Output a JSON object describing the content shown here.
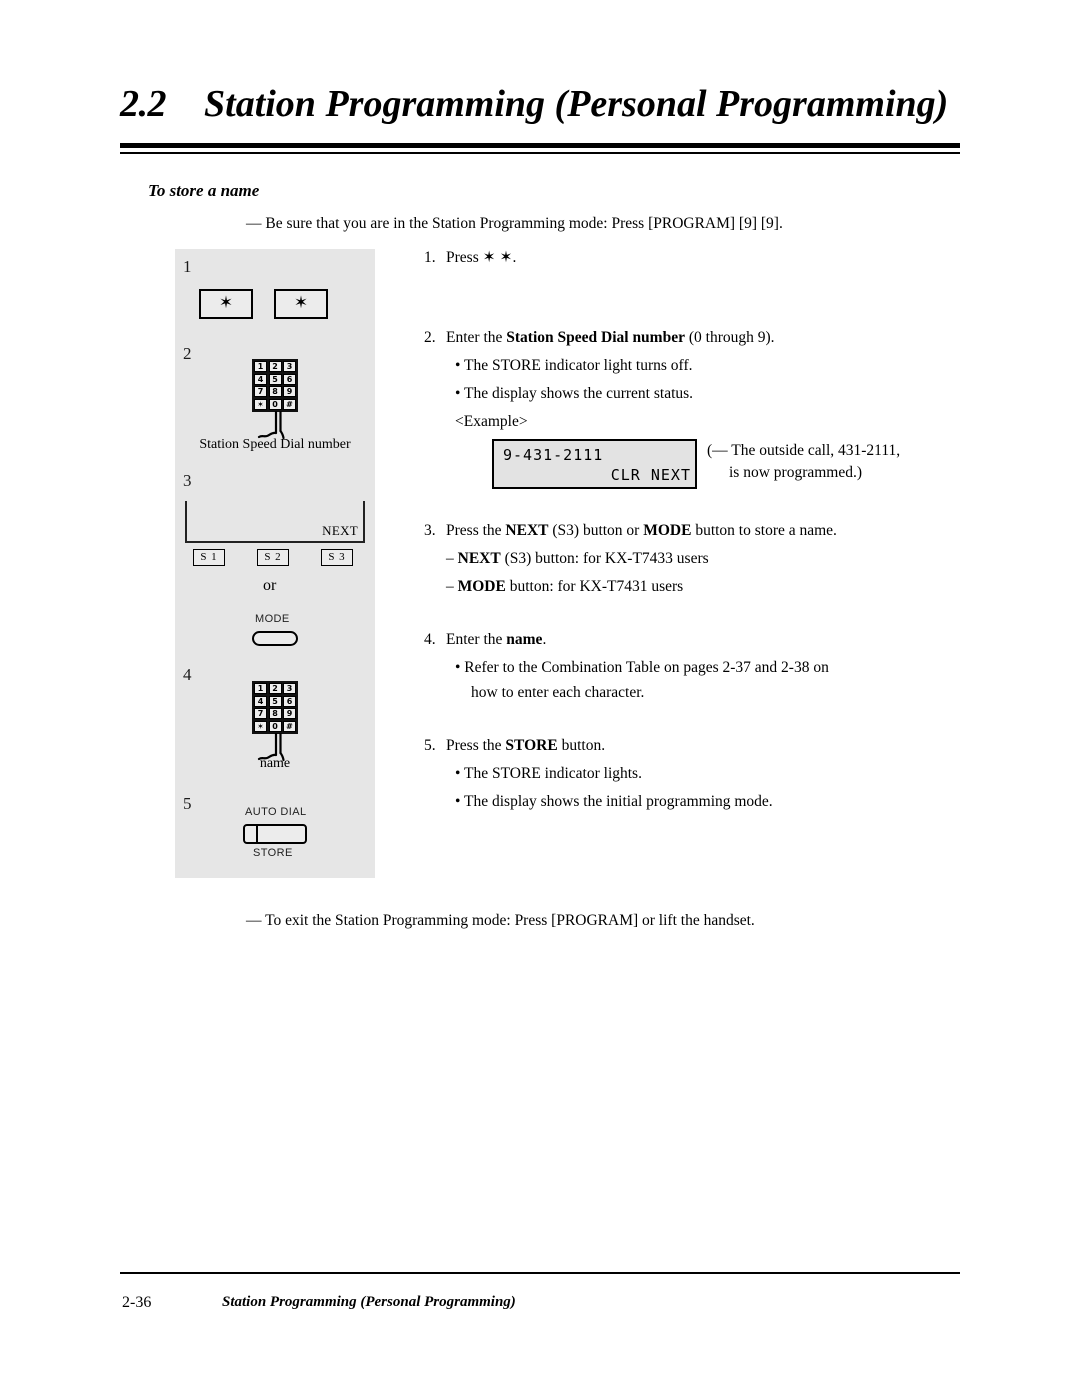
{
  "header": {
    "section_number": "2.2",
    "section_title": "Station Programming (Personal Programming)"
  },
  "subsection": {
    "title": "To store a name",
    "lead_note": "— Be sure that you are in the Station Programming mode: Press [PROGRAM] [9] [9].",
    "exit_note": "— To exit the Station Programming mode: Press [PROGRAM] or lift the handset."
  },
  "diagram": {
    "step_labels": [
      "1",
      "2",
      "3",
      "4",
      "5"
    ],
    "asterisk_glyph": "✶",
    "keypad_keys": [
      "1",
      "2",
      "3",
      "4",
      "5",
      "6",
      "7",
      "8",
      "9",
      "✶",
      "0",
      "#"
    ],
    "caption_step2": "Station Speed Dial number",
    "caption_step4": "name",
    "display_next_label": "NEXT",
    "soft_buttons": [
      "S 1",
      "S 2",
      "S 3"
    ],
    "or_label": "or",
    "mode_label": "MODE",
    "auto_dial_label": "AUTO DIAL",
    "store_label": "STORE"
  },
  "steps": {
    "s1": {
      "num": "1.",
      "text": "Press ✶ ✶."
    },
    "s2": {
      "num": "2.",
      "text_a": "Enter the ",
      "text_bold": "Station Speed Dial number",
      "text_b": " (0 through 9).",
      "bullets": [
        "• The STORE indicator light turns off.",
        "• The display shows the current status."
      ],
      "example_label": "<Example>"
    },
    "s3": {
      "num": "3.",
      "lead_a": "Press the ",
      "lead_bold1": "NEXT",
      "lead_b": " (S3) button or ",
      "lead_bold2": "MODE",
      "lead_c": " button to store a name.",
      "sub1_dash": "– ",
      "sub1_bold": "NEXT",
      "sub1_rest": " (S3) button: for KX-T7433 users",
      "sub2_dash": "– ",
      "sub2_bold": "MODE",
      "sub2_rest": " button: for KX-T7431 users"
    },
    "s4": {
      "num": "4.",
      "text_a": "Enter the ",
      "text_bold": "name",
      "text_b": ".",
      "bullet_line1": "• Refer to the Combination Table on pages 2-37 and 2-38 on",
      "bullet_line2": "how to enter each character."
    },
    "s5": {
      "num": "5.",
      "text_a": "Press the ",
      "text_bold": "STORE",
      "text_b": " button.",
      "bullets": [
        "• The STORE indicator lights.",
        "• The display shows the initial programming mode."
      ]
    }
  },
  "lcd": {
    "line1": "9-431-2111",
    "line2": "CLR   NEXT",
    "note_line1": "(— The outside call, 431-2111,",
    "note_line2": "is now programmed.)"
  },
  "footer": {
    "page_number": "2-36",
    "title": "Station Programming (Personal Programming)"
  },
  "colors": {
    "panel_bg": "#e6e6e6",
    "lcd_bg": "#e3e3e3",
    "keypad_bg": "#111111",
    "text": "#000000"
  }
}
